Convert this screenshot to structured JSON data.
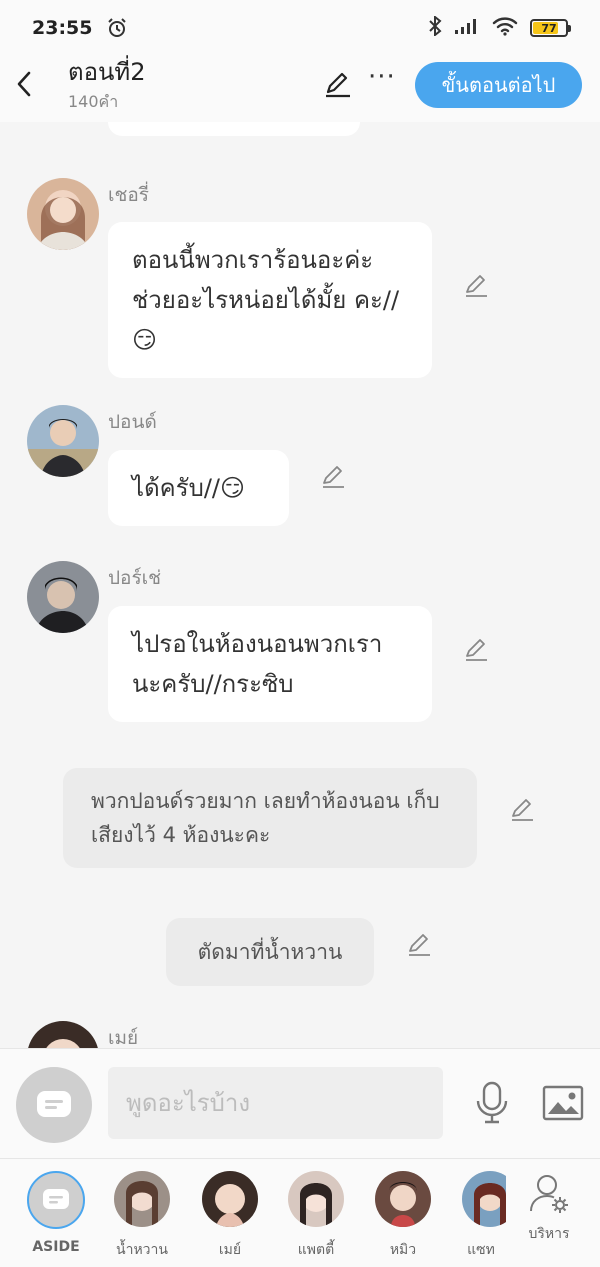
{
  "status_bar": {
    "time": "23:55",
    "battery": "77",
    "battery_level": 0.77
  },
  "header": {
    "title": "ตอนที่2",
    "word_count": "140คำ",
    "more_label": "···",
    "next_button": "ขั้นตอนต่อไป"
  },
  "messages": [
    {
      "sender": "เชอรี่",
      "text": "ตอนนี้พวกเราร้อนอะค่ะ ช่วยอะไรหน่อยได้มั้ย คะ//😏"
    },
    {
      "sender": "ปอนด์",
      "text": "ได้ครับ//😏"
    },
    {
      "sender": "ปอร์เช่",
      "text": "ไปรอในห้องนอนพวกเรา นะครับ//กระซิบ"
    },
    {
      "sender": "เมย์"
    }
  ],
  "narrations": [
    {
      "text": "พวกปอนด์รวยมาก เลยทำห้องนอน เก็บเสียงไว้ 4 ห้องนะคะ"
    },
    {
      "text": "ตัดมาที่น้ำหวาน"
    }
  ],
  "input": {
    "placeholder": "พูดอะไรบ้าง"
  },
  "characters": [
    {
      "name": "ASIDE"
    },
    {
      "name": "น้ำหวาน"
    },
    {
      "name": "เมย์"
    },
    {
      "name": "แพตตี้"
    },
    {
      "name": "หมิว"
    },
    {
      "name": "แซท"
    },
    {
      "name": "บริหาร"
    }
  ],
  "colors": {
    "accent": "#4aa6ee",
    "background": "#f5f5f5",
    "bubble": "#ffffff",
    "narration": "#ebebeb"
  }
}
